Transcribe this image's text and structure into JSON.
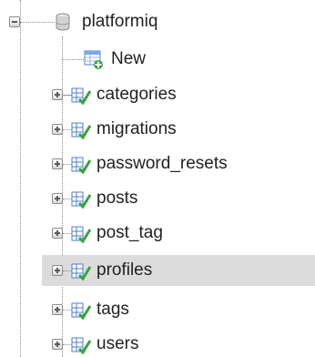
{
  "tree": {
    "database": {
      "name": "platformiq",
      "icon": "database-icon"
    },
    "new_item": {
      "label": "New",
      "icon": "new-table-icon"
    },
    "tables": [
      {
        "label": "categories",
        "icon": "table-icon",
        "selected": false
      },
      {
        "label": "migrations",
        "icon": "table-icon",
        "selected": false
      },
      {
        "label": "password_resets",
        "icon": "table-icon",
        "selected": false
      },
      {
        "label": "posts",
        "icon": "table-icon",
        "selected": false
      },
      {
        "label": "post_tag",
        "icon": "table-icon",
        "selected": false
      },
      {
        "label": "profiles",
        "icon": "table-icon",
        "selected": true
      },
      {
        "label": "tags",
        "icon": "table-icon",
        "selected": false
      },
      {
        "label": "users",
        "icon": "table-icon",
        "selected": false
      }
    ]
  },
  "colors": {
    "selected_row": "#dcdcdc",
    "tree_line": "#8c8c8c",
    "table_icon_blue": "#4a7fd4",
    "table_icon_green": "#3aa33a"
  }
}
